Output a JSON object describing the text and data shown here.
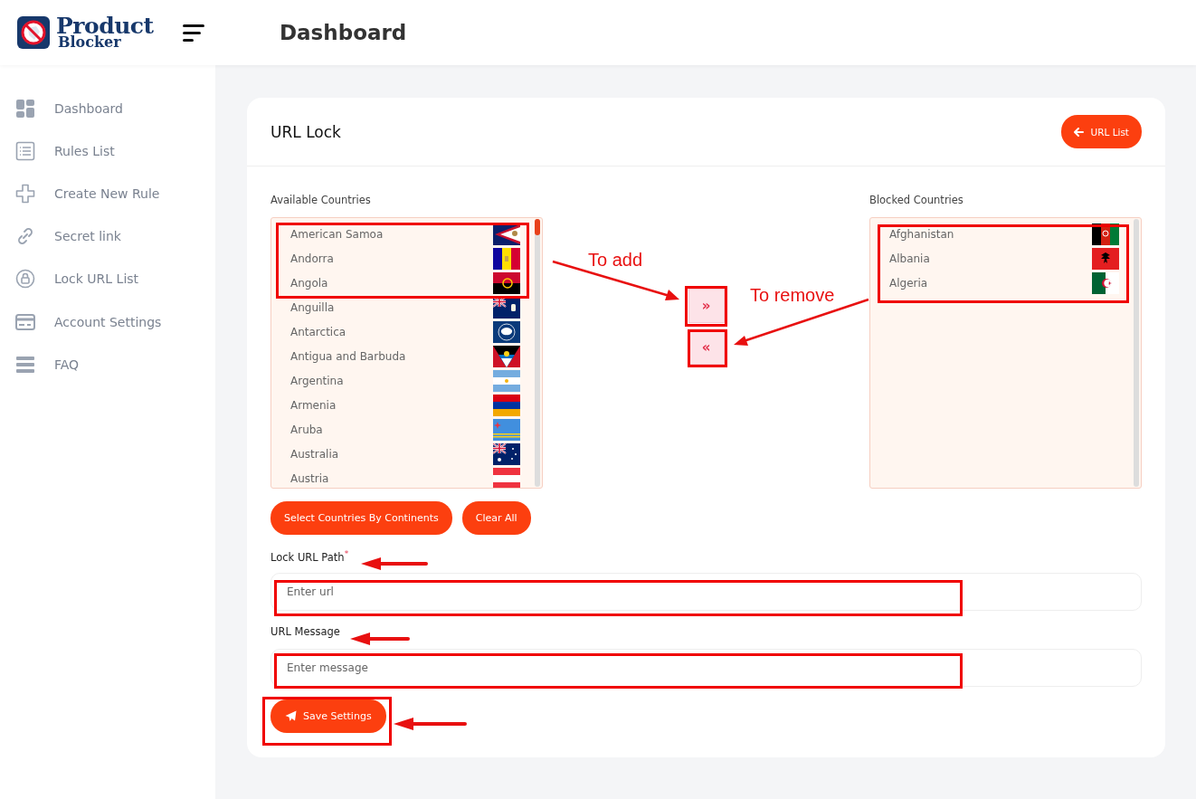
{
  "brand": {
    "line_1": "Product",
    "line_2": "Blocker"
  },
  "header": {
    "title": "Dashboard"
  },
  "sidebar": {
    "items": [
      {
        "kind": "dashboard",
        "label": "Dashboard"
      },
      {
        "kind": "rules",
        "label": "Rules List"
      },
      {
        "kind": "create",
        "label": "Create New Rule"
      },
      {
        "kind": "link",
        "label": "Secret link"
      },
      {
        "kind": "lock",
        "label": "Lock URL List"
      },
      {
        "kind": "account",
        "label": "Account Settings"
      },
      {
        "kind": "faq",
        "label": "FAQ"
      }
    ]
  },
  "card": {
    "title": "URL Lock",
    "back_button": "URL List"
  },
  "available": {
    "label": "Available Countries",
    "countries": [
      "American Samoa",
      "Andorra",
      "Angola",
      "Anguilla",
      "Antarctica",
      "Antigua and Barbuda",
      "Argentina",
      "Armenia",
      "Aruba",
      "Australia",
      "Austria"
    ]
  },
  "move_buttons": {
    "add": "»",
    "remove": "«"
  },
  "blocked": {
    "label": "Blocked Countries",
    "countries": [
      "Afghanistan",
      "Albania",
      "Algeria"
    ]
  },
  "action_buttons": [
    "Select Countries By Continents",
    "Clear All"
  ],
  "fields": [
    {
      "label": "Lock URL Path",
      "required_mark": "*",
      "placeholder": "Enter url"
    },
    {
      "label": "URL Message",
      "placeholder": "Enter message"
    }
  ],
  "save_button": "Save Settings",
  "annotations": {
    "labels": [
      "To add",
      "To remove"
    ]
  }
}
